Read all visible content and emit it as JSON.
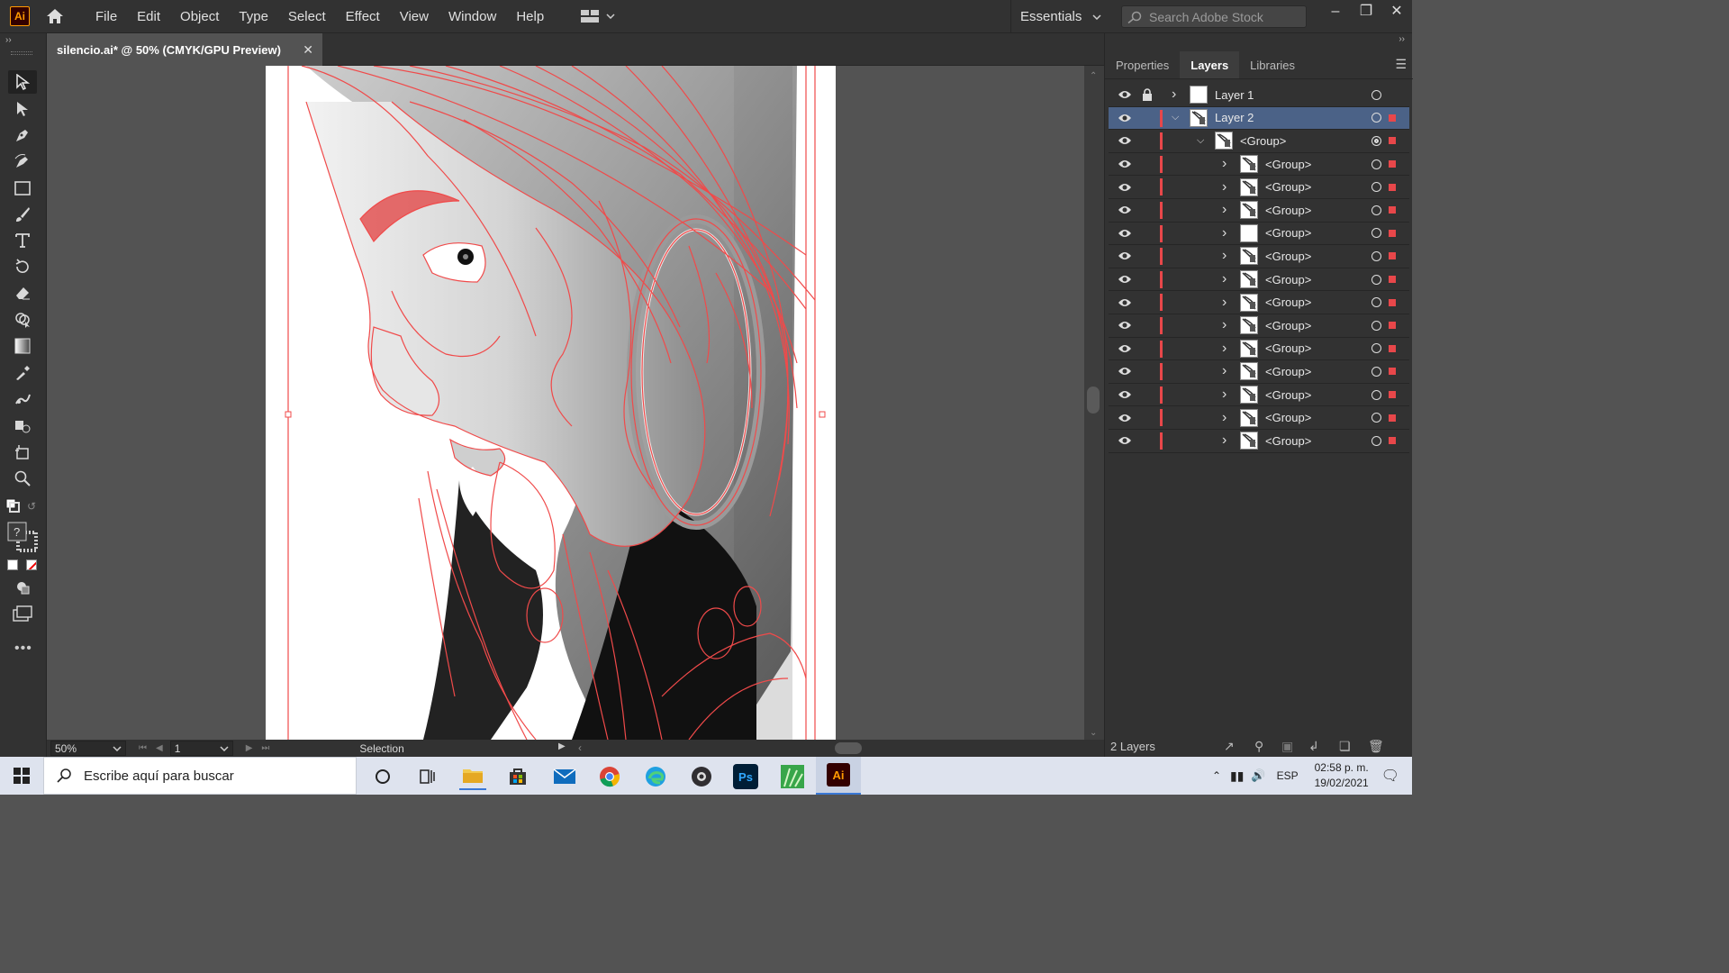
{
  "app": {
    "logo": "Ai",
    "menu": [
      "File",
      "Edit",
      "Object",
      "Type",
      "Select",
      "Effect",
      "View",
      "Window",
      "Help"
    ],
    "workspace": "Essentials",
    "search_placeholder": "Search Adobe Stock"
  },
  "document": {
    "tab_title": "silencio.ai* @ 50% (CMYK/GPU Preview)"
  },
  "status": {
    "zoom": "50%",
    "page": "1",
    "mode": "Selection"
  },
  "panel": {
    "tabs": [
      "Properties",
      "Layers",
      "Libraries"
    ],
    "active_tab": "Layers",
    "footer_count": "2 Layers",
    "layers": [
      {
        "name": "Layer 1",
        "level": 0,
        "expanded": false,
        "selected": false,
        "locked": true
      },
      {
        "name": "Layer 2",
        "level": 0,
        "expanded": true,
        "selected": true,
        "locked": false
      },
      {
        "name": "<Group>",
        "level": 1,
        "expanded": true,
        "selected": false,
        "locked": false
      },
      {
        "name": "<Group>",
        "level": 2,
        "expanded": false,
        "selected": false,
        "locked": false
      },
      {
        "name": "<Group>",
        "level": 2,
        "expanded": false,
        "selected": false,
        "locked": false
      },
      {
        "name": "<Group>",
        "level": 2,
        "expanded": false,
        "selected": false,
        "locked": false
      },
      {
        "name": "<Group>",
        "level": 2,
        "expanded": false,
        "selected": false,
        "locked": false
      },
      {
        "name": "<Group>",
        "level": 2,
        "expanded": false,
        "selected": false,
        "locked": false
      },
      {
        "name": "<Group>",
        "level": 2,
        "expanded": false,
        "selected": false,
        "locked": false
      },
      {
        "name": "<Group>",
        "level": 2,
        "expanded": false,
        "selected": false,
        "locked": false
      },
      {
        "name": "<Group>",
        "level": 2,
        "expanded": false,
        "selected": false,
        "locked": false
      },
      {
        "name": "<Group>",
        "level": 2,
        "expanded": false,
        "selected": false,
        "locked": false
      },
      {
        "name": "<Group>",
        "level": 2,
        "expanded": false,
        "selected": false,
        "locked": false
      },
      {
        "name": "<Group>",
        "level": 2,
        "expanded": false,
        "selected": false,
        "locked": false
      },
      {
        "name": "<Group>",
        "level": 2,
        "expanded": false,
        "selected": false,
        "locked": false
      },
      {
        "name": "<Group>",
        "level": 2,
        "expanded": false,
        "selected": false,
        "locked": false
      }
    ],
    "layer_color": "#e8474a"
  },
  "tools": [
    "selection-tool",
    "direct-selection-tool",
    "pen-tool",
    "curvature-tool",
    "rectangle-tool",
    "paintbrush-tool",
    "type-tool",
    "rotate-tool",
    "eraser-tool",
    "shape-builder-tool",
    "gradient-tool",
    "eyedropper-tool",
    "puppet-warp-tool",
    "symbol-sprayer-tool",
    "artboard-tool",
    "zoom-tool"
  ],
  "taskbar": {
    "search_placeholder": "Escribe aquí para buscar",
    "language": "ESP",
    "time": "02:58 p. m.",
    "date": "19/02/2021",
    "apps": [
      "Ps",
      "Ai"
    ]
  }
}
